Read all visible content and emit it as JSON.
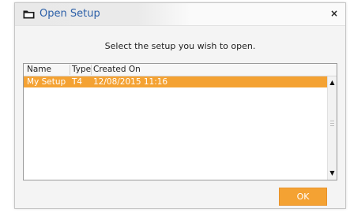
{
  "dialog": {
    "title": "Open Setup",
    "close_glyph": "×",
    "prompt": "Select the setup you wish to open.",
    "ok_label": "OK"
  },
  "list": {
    "columns": [
      "Name",
      "Type",
      "Created On"
    ],
    "rows": [
      {
        "name": "My Setup",
        "type": "T4",
        "created_on": "12/08/2015 11:16",
        "selected": true
      }
    ]
  },
  "icons": {
    "title": "folder-icon",
    "close": "close-icon",
    "scroll_up": "scroll-up-arrow-icon",
    "scroll_down": "scroll-down-arrow-icon"
  },
  "colors": {
    "accent": "#f4a233",
    "title_text": "#2b5fa8"
  }
}
